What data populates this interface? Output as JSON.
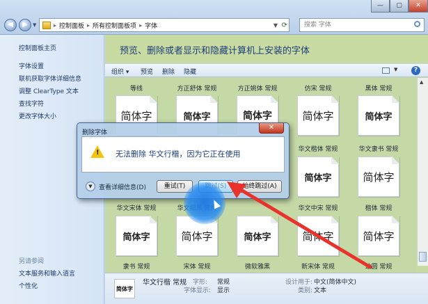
{
  "window": {
    "address_crumbs": [
      "控制面板",
      "所有控制面板项",
      "字体"
    ],
    "search_placeholder": "搜索 字体",
    "minimize": "—",
    "maximize": "▢",
    "close": "✕"
  },
  "sidebar": {
    "home": "控制面板主页",
    "links": [
      "字体设置",
      "联机获取字体详细信息",
      "调整 ClearType 文本",
      "查找字符",
      "更改字体大小"
    ],
    "see_also_heading": "另请参阅",
    "see_also": [
      "文本服务和输入语言",
      "个性化"
    ]
  },
  "main": {
    "heading": "预览、删除或者显示和隐藏计算机上安装的字体",
    "toolbar": [
      "组织 ▾",
      "预览",
      "删除",
      "隐藏"
    ],
    "help": "?",
    "fonts_row1_labels": [
      "等线",
      "方正舒体 常规",
      "方正姚体 常规",
      "仿宋 常规",
      "黑体 常规"
    ],
    "fonts_row1_samples": [
      "简体字",
      "简体字",
      "简体字",
      "简体字",
      "简体字"
    ],
    "fonts_row2_labels": [
      "华文楷体 常规",
      "华文隶书 常规"
    ],
    "fonts_row2_samples": [
      "简体字",
      "简体字"
    ],
    "fonts_row3_labels": [
      "华文宋体 常规",
      "华文细黑 常规",
      "华文中宋 常规",
      "楷体 常规"
    ],
    "fonts_row3_samples": [
      "简体字",
      "简体字",
      "简体字",
      "简体字",
      "简体字"
    ],
    "fonts_row4_labels": [
      "隶书 常规",
      "宋体 常规",
      "微软雅黑",
      "新宋体 常规",
      "幼圆 常规"
    ]
  },
  "details": {
    "thumb": "简体字",
    "name": "华文行楷 常规",
    "style_key": "字形:",
    "style_val": "常规",
    "display_key": "字体显示:",
    "display_val": "显示",
    "designed_key": "设计用于:",
    "designed_val": "中文(简体中文)",
    "category_key": "类别:",
    "category_val": "文本"
  },
  "dialog": {
    "title": "删除字体",
    "close": "✕",
    "message": "无法删除 华文行楷，因为它正在使用",
    "details_toggle": "查看详细信息(D)",
    "retry": "重试(T)",
    "skip": "跳过(S)",
    "skip_all": "始终跳过(A)"
  },
  "colors": {
    "accent_arrow": "#e8322c",
    "highlight": "#1e78e6",
    "warning": "#f2c40f"
  }
}
